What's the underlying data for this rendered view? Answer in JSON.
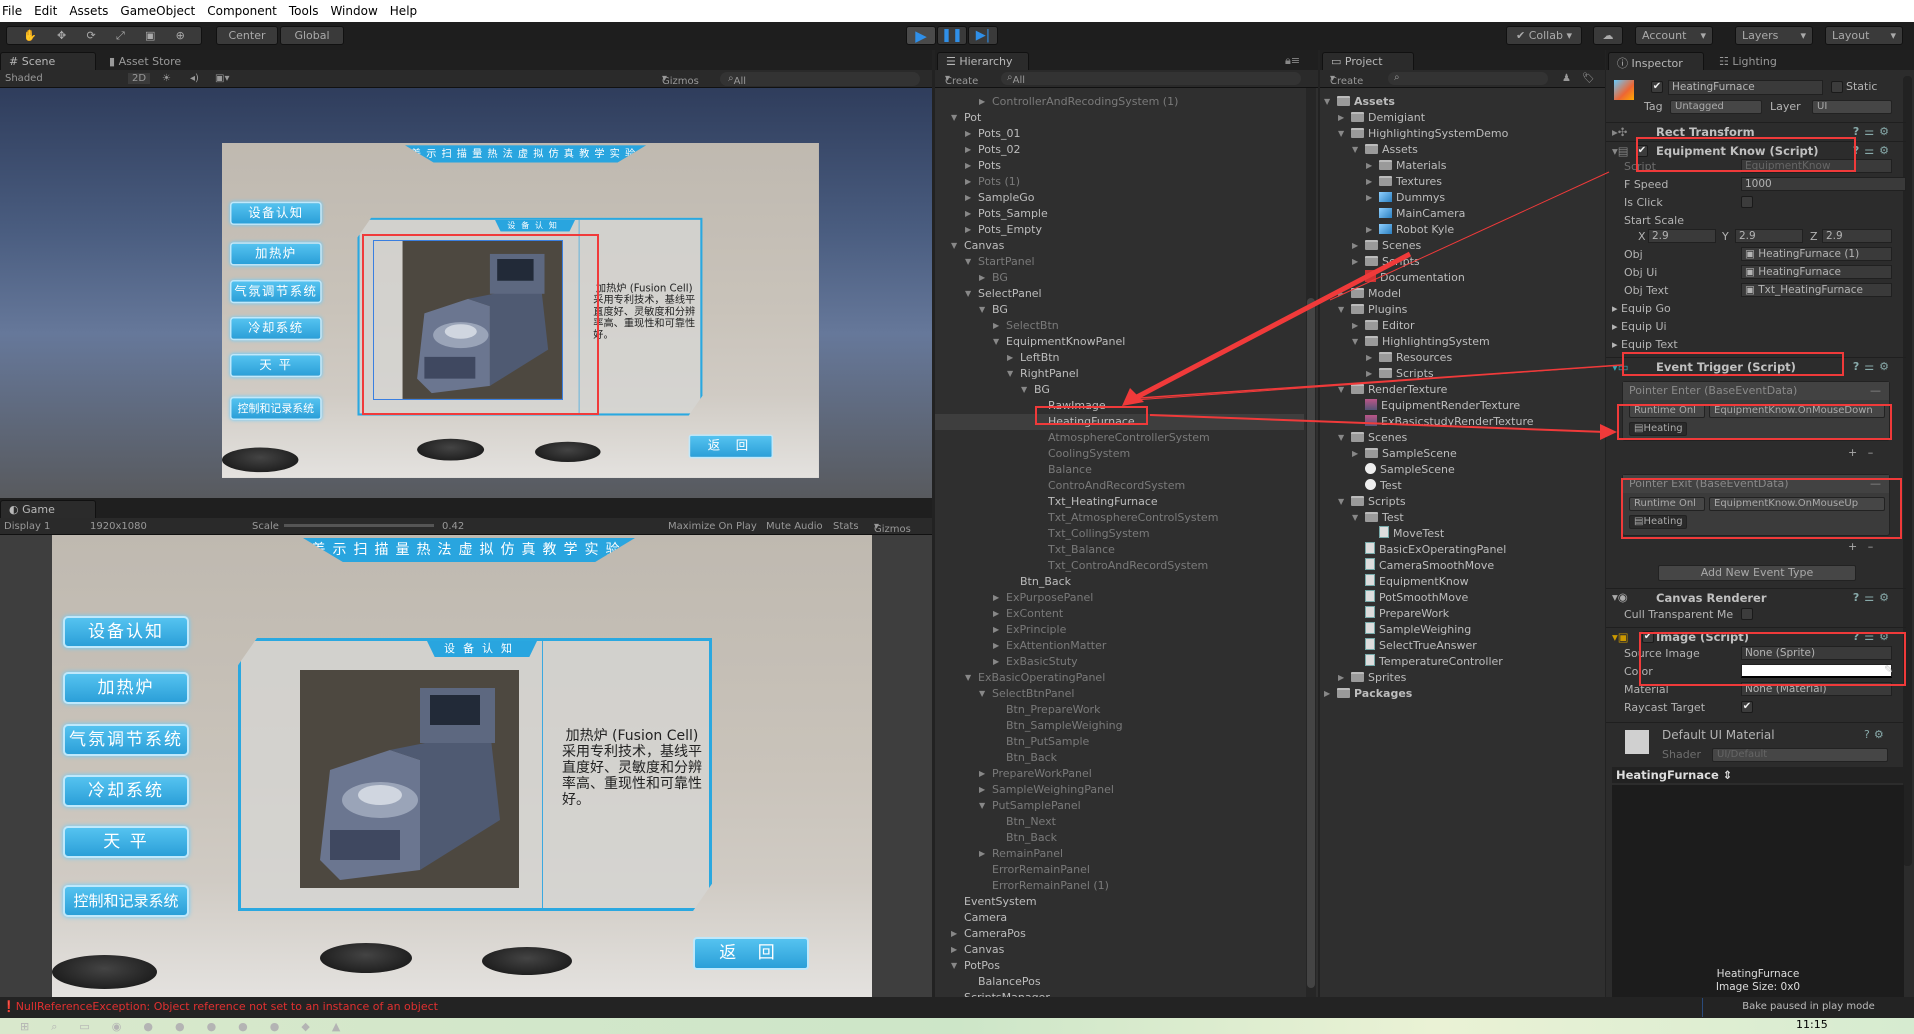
{
  "menu": [
    "File",
    "Edit",
    "Assets",
    "GameObject",
    "Component",
    "Tools",
    "Window",
    "Help"
  ],
  "toolbar": {
    "pivot": "Center",
    "space": "Global",
    "collab": "Collab",
    "account": "Account",
    "layers": "Layers",
    "layout": "Layout",
    "play_state": "playing",
    "accent": "#2f8fe8"
  },
  "scene": {
    "tabs": [
      "Scene",
      "Asset Store"
    ],
    "shading": "Shaded",
    "mode2d": "2D",
    "gizmos": "Gizmos",
    "search": "All"
  },
  "game": {
    "tab": "Game",
    "display": "Display 1",
    "resolution": "1920x1080",
    "scale_label": "Scale",
    "scale": "0.42",
    "maximize": "Maximize On Play",
    "mute": "Mute Audio",
    "stats": "Stats",
    "gizmos": "Gizmos"
  },
  "gameui": {
    "title": "差示扫描量热法虚拟仿真教学实验",
    "buttons": [
      "设备认知",
      "加热炉",
      "气氛调节系统",
      "冷却系统",
      "天 平",
      "控制和记录系统"
    ],
    "panel_tab": "设备认知",
    "desc_title": "加热炉 (Fusion Cell)",
    "desc_body": "采用专利技术，基线平直度好、灵敏度和分辨率高、重现性和可靠性好。",
    "back": "返 回",
    "accent": "#29a5df"
  },
  "hierarchy": {
    "tab": "Hierarchy",
    "create": "Create",
    "search": "All",
    "items": [
      {
        "t": "ControllerAndRecodingSystem (1)",
        "l": 2,
        "a": "r",
        "d": 1
      },
      {
        "t": "Pot",
        "l": 0,
        "a": "d"
      },
      {
        "t": "Pots_01",
        "l": 1,
        "a": "r"
      },
      {
        "t": "Pots_02",
        "l": 1,
        "a": "r"
      },
      {
        "t": "Pots",
        "l": 1,
        "a": "r"
      },
      {
        "t": "Pots (1)",
        "l": 1,
        "a": "r",
        "d": 1
      },
      {
        "t": "SampleGo",
        "l": 1,
        "a": "r"
      },
      {
        "t": "Pots_Sample",
        "l": 1,
        "a": "r"
      },
      {
        "t": "Pots_Empty",
        "l": 1,
        "a": "r"
      },
      {
        "t": "Canvas",
        "l": 0,
        "a": "d"
      },
      {
        "t": "StartPanel",
        "l": 1,
        "a": "d",
        "d": 1
      },
      {
        "t": "BG",
        "l": 2,
        "a": "r",
        "d": 1
      },
      {
        "t": "SelectPanel",
        "l": 1,
        "a": "d"
      },
      {
        "t": "BG",
        "l": 2,
        "a": "d"
      },
      {
        "t": "SelectBtn",
        "l": 3,
        "a": "r",
        "d": 1
      },
      {
        "t": "EquipmentKnowPanel",
        "l": 3,
        "a": "d"
      },
      {
        "t": "LeftBtn",
        "l": 4,
        "a": "r"
      },
      {
        "t": "RightPanel",
        "l": 4,
        "a": "d"
      },
      {
        "t": "BG",
        "l": 5,
        "a": "d"
      },
      {
        "t": "RawImage",
        "l": 6
      },
      {
        "t": "HeatingFurnace",
        "l": 6,
        "s": 1
      },
      {
        "t": "AtmosphereControllerSystem",
        "l": 6,
        "d": 1
      },
      {
        "t": "CoolingSystem",
        "l": 6,
        "d": 1
      },
      {
        "t": "Balance",
        "l": 6,
        "d": 1
      },
      {
        "t": "ControAndRecordSystem",
        "l": 6,
        "d": 1
      },
      {
        "t": "Txt_HeatingFurnace",
        "l": 6
      },
      {
        "t": "Txt_AtmosphereControlSystem",
        "l": 6,
        "d": 1
      },
      {
        "t": "Txt_CollingSystem",
        "l": 6,
        "d": 1
      },
      {
        "t": "Txt_Balance",
        "l": 6,
        "d": 1
      },
      {
        "t": "Txt_ControAndRecordSystem",
        "l": 6,
        "d": 1
      },
      {
        "t": "Btn_Back",
        "l": 4
      },
      {
        "t": "ExPurposePanel",
        "l": 3,
        "a": "r",
        "d": 1
      },
      {
        "t": "ExContent",
        "l": 3,
        "a": "r",
        "d": 1
      },
      {
        "t": "ExPrinciple",
        "l": 3,
        "a": "r",
        "d": 1
      },
      {
        "t": "ExAttentionMatter",
        "l": 3,
        "a": "r",
        "d": 1
      },
      {
        "t": "ExBasicStuty",
        "l": 3,
        "a": "r",
        "d": 1
      },
      {
        "t": "ExBasicOperatingPanel",
        "l": 1,
        "a": "d",
        "d": 1
      },
      {
        "t": "SelectBtnPanel",
        "l": 2,
        "a": "d",
        "d": 1
      },
      {
        "t": "Btn_PrepareWork",
        "l": 3,
        "d": 1
      },
      {
        "t": "Btn_SampleWeighing",
        "l": 3,
        "d": 1
      },
      {
        "t": "Btn_PutSample",
        "l": 3,
        "d": 1
      },
      {
        "t": "Btn_Back",
        "l": 3,
        "d": 1
      },
      {
        "t": "PrepareWorkPanel",
        "l": 2,
        "a": "r",
        "d": 1
      },
      {
        "t": "SampleWeighingPanel",
        "l": 2,
        "a": "r",
        "d": 1
      },
      {
        "t": "PutSamplePanel",
        "l": 2,
        "a": "d",
        "d": 1
      },
      {
        "t": "Btn_Next",
        "l": 3,
        "d": 1
      },
      {
        "t": "Btn_Back",
        "l": 3,
        "d": 1
      },
      {
        "t": "RemainPanel",
        "l": 2,
        "a": "r",
        "d": 1
      },
      {
        "t": "ErrorRemainPanel",
        "l": 2,
        "d": 1
      },
      {
        "t": "ErrorRemainPanel (1)",
        "l": 2,
        "d": 1
      },
      {
        "t": "EventSystem",
        "l": 0
      },
      {
        "t": "Camera",
        "l": 0
      },
      {
        "t": "CameraPos",
        "l": 0,
        "a": "r"
      },
      {
        "t": "Canvas",
        "l": 0,
        "a": "r"
      },
      {
        "t": "PotPos",
        "l": 0,
        "a": "d"
      },
      {
        "t": "BalancePos",
        "l": 1
      },
      {
        "t": "ScriptsManager",
        "l": 0
      }
    ]
  },
  "project": {
    "tab": "Project",
    "create": "Create",
    "items": [
      {
        "t": "Assets",
        "l": 0,
        "a": "d",
        "i": "folder",
        "b": 1
      },
      {
        "t": "Demigiant",
        "l": 1,
        "a": "r",
        "i": "folder"
      },
      {
        "t": "HighlightingSystemDemo",
        "l": 1,
        "a": "d",
        "i": "folder"
      },
      {
        "t": "Assets",
        "l": 2,
        "a": "d",
        "i": "folder"
      },
      {
        "t": "Materials",
        "l": 3,
        "a": "r",
        "i": "folder"
      },
      {
        "t": "Textures",
        "l": 3,
        "a": "r",
        "i": "folder"
      },
      {
        "t": "Dummys",
        "l": 3,
        "a": "r",
        "i": "prefab"
      },
      {
        "t": "MainCamera",
        "l": 3,
        "i": "prefab"
      },
      {
        "t": "Robot Kyle",
        "l": 3,
        "a": "r",
        "i": "prefab"
      },
      {
        "t": "Scenes",
        "l": 2,
        "a": "r",
        "i": "folder"
      },
      {
        "t": "Scripts",
        "l": 2,
        "a": "r",
        "i": "folder"
      },
      {
        "t": "Documentation",
        "l": 2,
        "i": "pdf"
      },
      {
        "t": "Model",
        "l": 1,
        "a": "r",
        "i": "folder"
      },
      {
        "t": "Plugins",
        "l": 1,
        "a": "d",
        "i": "folder"
      },
      {
        "t": "Editor",
        "l": 2,
        "a": "r",
        "i": "folder"
      },
      {
        "t": "HighlightingSystem",
        "l": 2,
        "a": "d",
        "i": "folder"
      },
      {
        "t": "Resources",
        "l": 3,
        "a": "r",
        "i": "folder"
      },
      {
        "t": "Scripts",
        "l": 3,
        "a": "r",
        "i": "folder"
      },
      {
        "t": "RenderTexture",
        "l": 1,
        "a": "d",
        "i": "folder"
      },
      {
        "t": "EquipmentRenderTexture",
        "l": 2,
        "i": "rt"
      },
      {
        "t": "ExBasicstudyRenderTexture",
        "l": 2,
        "i": "rt"
      },
      {
        "t": "Scenes",
        "l": 1,
        "a": "d",
        "i": "folder"
      },
      {
        "t": "SampleScene",
        "l": 2,
        "a": "r",
        "i": "folder"
      },
      {
        "t": "SampleScene",
        "l": 2,
        "i": "unity"
      },
      {
        "t": "Test",
        "l": 2,
        "i": "unity"
      },
      {
        "t": "Scripts",
        "l": 1,
        "a": "d",
        "i": "folder"
      },
      {
        "t": "Test",
        "l": 2,
        "a": "d",
        "i": "folder"
      },
      {
        "t": "MoveTest",
        "l": 3,
        "i": "cs"
      },
      {
        "t": "BasicExOperatingPanel",
        "l": 2,
        "i": "cs"
      },
      {
        "t": "CameraSmoothMove",
        "l": 2,
        "i": "cs"
      },
      {
        "t": "EquipmentKnow",
        "l": 2,
        "i": "cs"
      },
      {
        "t": "PotSmoothMove",
        "l": 2,
        "i": "cs"
      },
      {
        "t": "PrepareWork",
        "l": 2,
        "i": "cs"
      },
      {
        "t": "SampleWeighing",
        "l": 2,
        "i": "cs"
      },
      {
        "t": "SelectTrueAnswer",
        "l": 2,
        "i": "cs"
      },
      {
        "t": "TemperatureController",
        "l": 2,
        "i": "cs"
      },
      {
        "t": "Sprites",
        "l": 1,
        "a": "r",
        "i": "folder"
      },
      {
        "t": "Packages",
        "l": 0,
        "a": "r",
        "i": "folder",
        "b": 1
      }
    ]
  },
  "inspector": {
    "tabs": [
      "Inspector",
      "Lighting"
    ],
    "name": "HeatingFurnace",
    "static": "Static",
    "tag_label": "Tag",
    "tag": "Untagged",
    "layer_label": "Layer",
    "layer": "UI",
    "rect": "Rect Transform",
    "equip": {
      "title": "Equipment Know (Script)",
      "script_label": "Script",
      "script": "EquipmentKnow",
      "fspeed_label": "F Speed",
      "fspeed": "1000",
      "isclick_label": "Is Click",
      "isclick": false,
      "scale_label": "Start Scale",
      "x": "2.9",
      "y": "2.9",
      "z": "2.9",
      "obj_label": "Obj",
      "obj": "HeatingFurnace (1)",
      "objui_label": "Obj Ui",
      "objui": "HeatingFurnace",
      "objtext_label": "Obj Text",
      "objtext": "Txt_HeatingFurnace",
      "equipgo": "Equip Go",
      "equipui": "Equip Ui",
      "equiptext": "Equip Text"
    },
    "event": {
      "title": "Event Trigger (Script)",
      "enter": {
        "header": "Pointer Enter (BaseEventData)",
        "mode": "Runtime Onl",
        "func": "EquipmentKnow.OnMouseDown",
        "target": "Heating"
      },
      "exit": {
        "header": "Pointer Exit (BaseEventData)",
        "mode": "Runtime Onl",
        "func": "EquipmentKnow.OnMouseUp",
        "target": "Heating"
      },
      "add": "Add New Event Type"
    },
    "canvas": {
      "title": "Canvas Renderer",
      "cull": "Cull Transparent Me"
    },
    "image": {
      "title": "Image (Script)",
      "source_label": "Source Image",
      "source": "None (Sprite)",
      "color_label": "Color",
      "color": "#ffffff",
      "material_label": "Material",
      "material": "None (Material)",
      "raycast_label": "Raycast Target",
      "raycast": true
    },
    "material": {
      "title": "Default UI Material",
      "shader_label": "Shader",
      "shader": "UI/Default"
    },
    "preview_title": "HeatingFurnace",
    "preview_name": "HeatingFurnace",
    "preview_size": "Image Size: 0x0"
  },
  "status": {
    "error": "NullReferenceException: Object reference not set to an instance of an object",
    "bake": "Bake paused in play mode",
    "error_color": "#e03030"
  },
  "taskbar": {
    "time": "11:15"
  },
  "annotation_color": "#f03a3a"
}
